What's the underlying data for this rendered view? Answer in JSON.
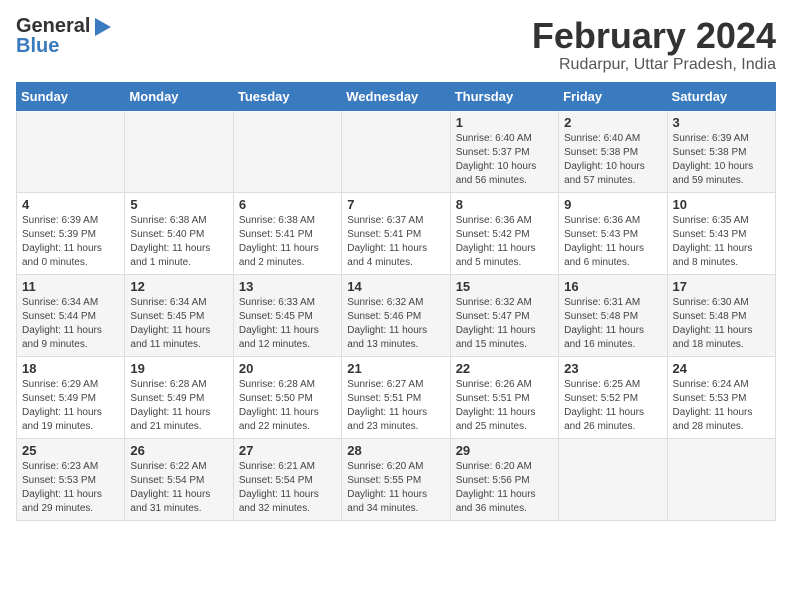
{
  "logo": {
    "general": "General",
    "blue": "Blue"
  },
  "title": "February 2024",
  "subtitle": "Rudarpur, Uttar Pradesh, India",
  "days_header": [
    "Sunday",
    "Monday",
    "Tuesday",
    "Wednesday",
    "Thursday",
    "Friday",
    "Saturday"
  ],
  "weeks": [
    [
      {
        "num": "",
        "info": ""
      },
      {
        "num": "",
        "info": ""
      },
      {
        "num": "",
        "info": ""
      },
      {
        "num": "",
        "info": ""
      },
      {
        "num": "1",
        "info": "Sunrise: 6:40 AM\nSunset: 5:37 PM\nDaylight: 10 hours\nand 56 minutes."
      },
      {
        "num": "2",
        "info": "Sunrise: 6:40 AM\nSunset: 5:38 PM\nDaylight: 10 hours\nand 57 minutes."
      },
      {
        "num": "3",
        "info": "Sunrise: 6:39 AM\nSunset: 5:38 PM\nDaylight: 10 hours\nand 59 minutes."
      }
    ],
    [
      {
        "num": "4",
        "info": "Sunrise: 6:39 AM\nSunset: 5:39 PM\nDaylight: 11 hours\nand 0 minutes."
      },
      {
        "num": "5",
        "info": "Sunrise: 6:38 AM\nSunset: 5:40 PM\nDaylight: 11 hours\nand 1 minute."
      },
      {
        "num": "6",
        "info": "Sunrise: 6:38 AM\nSunset: 5:41 PM\nDaylight: 11 hours\nand 2 minutes."
      },
      {
        "num": "7",
        "info": "Sunrise: 6:37 AM\nSunset: 5:41 PM\nDaylight: 11 hours\nand 4 minutes."
      },
      {
        "num": "8",
        "info": "Sunrise: 6:36 AM\nSunset: 5:42 PM\nDaylight: 11 hours\nand 5 minutes."
      },
      {
        "num": "9",
        "info": "Sunrise: 6:36 AM\nSunset: 5:43 PM\nDaylight: 11 hours\nand 6 minutes."
      },
      {
        "num": "10",
        "info": "Sunrise: 6:35 AM\nSunset: 5:43 PM\nDaylight: 11 hours\nand 8 minutes."
      }
    ],
    [
      {
        "num": "11",
        "info": "Sunrise: 6:34 AM\nSunset: 5:44 PM\nDaylight: 11 hours\nand 9 minutes."
      },
      {
        "num": "12",
        "info": "Sunrise: 6:34 AM\nSunset: 5:45 PM\nDaylight: 11 hours\nand 11 minutes."
      },
      {
        "num": "13",
        "info": "Sunrise: 6:33 AM\nSunset: 5:45 PM\nDaylight: 11 hours\nand 12 minutes."
      },
      {
        "num": "14",
        "info": "Sunrise: 6:32 AM\nSunset: 5:46 PM\nDaylight: 11 hours\nand 13 minutes."
      },
      {
        "num": "15",
        "info": "Sunrise: 6:32 AM\nSunset: 5:47 PM\nDaylight: 11 hours\nand 15 minutes."
      },
      {
        "num": "16",
        "info": "Sunrise: 6:31 AM\nSunset: 5:48 PM\nDaylight: 11 hours\nand 16 minutes."
      },
      {
        "num": "17",
        "info": "Sunrise: 6:30 AM\nSunset: 5:48 PM\nDaylight: 11 hours\nand 18 minutes."
      }
    ],
    [
      {
        "num": "18",
        "info": "Sunrise: 6:29 AM\nSunset: 5:49 PM\nDaylight: 11 hours\nand 19 minutes."
      },
      {
        "num": "19",
        "info": "Sunrise: 6:28 AM\nSunset: 5:49 PM\nDaylight: 11 hours\nand 21 minutes."
      },
      {
        "num": "20",
        "info": "Sunrise: 6:28 AM\nSunset: 5:50 PM\nDaylight: 11 hours\nand 22 minutes."
      },
      {
        "num": "21",
        "info": "Sunrise: 6:27 AM\nSunset: 5:51 PM\nDaylight: 11 hours\nand 23 minutes."
      },
      {
        "num": "22",
        "info": "Sunrise: 6:26 AM\nSunset: 5:51 PM\nDaylight: 11 hours\nand 25 minutes."
      },
      {
        "num": "23",
        "info": "Sunrise: 6:25 AM\nSunset: 5:52 PM\nDaylight: 11 hours\nand 26 minutes."
      },
      {
        "num": "24",
        "info": "Sunrise: 6:24 AM\nSunset: 5:53 PM\nDaylight: 11 hours\nand 28 minutes."
      }
    ],
    [
      {
        "num": "25",
        "info": "Sunrise: 6:23 AM\nSunset: 5:53 PM\nDaylight: 11 hours\nand 29 minutes."
      },
      {
        "num": "26",
        "info": "Sunrise: 6:22 AM\nSunset: 5:54 PM\nDaylight: 11 hours\nand 31 minutes."
      },
      {
        "num": "27",
        "info": "Sunrise: 6:21 AM\nSunset: 5:54 PM\nDaylight: 11 hours\nand 32 minutes."
      },
      {
        "num": "28",
        "info": "Sunrise: 6:20 AM\nSunset: 5:55 PM\nDaylight: 11 hours\nand 34 minutes."
      },
      {
        "num": "29",
        "info": "Sunrise: 6:20 AM\nSunset: 5:56 PM\nDaylight: 11 hours\nand 36 minutes."
      },
      {
        "num": "",
        "info": ""
      },
      {
        "num": "",
        "info": ""
      }
    ]
  ]
}
